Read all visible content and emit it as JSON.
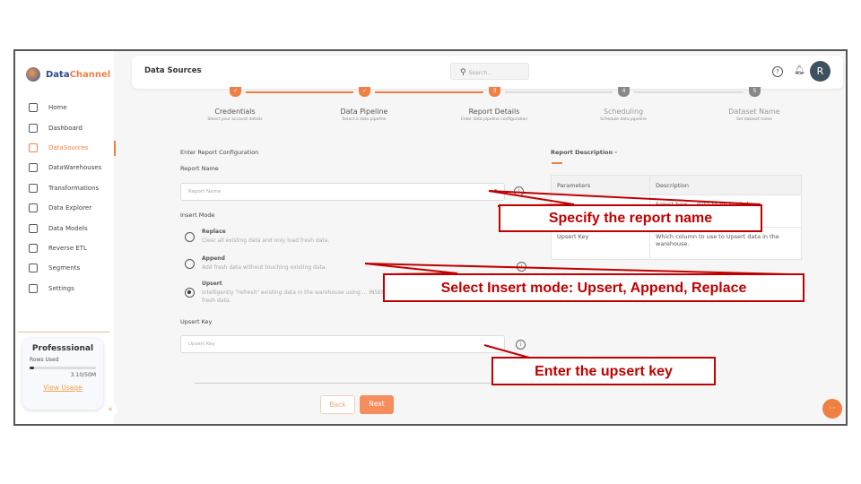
{
  "brand": {
    "name_part1": "Data",
    "name_part2": "Channel"
  },
  "sidebar": {
    "items": [
      {
        "label": "Home",
        "icon": "home-icon"
      },
      {
        "label": "Dashboard",
        "icon": "dashboard-icon"
      },
      {
        "label": "DataSources",
        "icon": "datasources-icon",
        "active": true
      },
      {
        "label": "DataWarehouses",
        "icon": "layers-icon"
      },
      {
        "label": "Transformations",
        "icon": "transform-icon"
      },
      {
        "label": "Data Explorer",
        "icon": "explorer-icon"
      },
      {
        "label": "Data Models",
        "icon": "models-icon"
      },
      {
        "label": "Reverse ETL",
        "icon": "reverse-etl-icon"
      },
      {
        "label": "Segments",
        "icon": "segments-icon"
      },
      {
        "label": "Settings",
        "icon": "gear-icon"
      }
    ],
    "plan": {
      "title": "Professsional",
      "rows_label": "Rows Used",
      "usage_fraction": 0.062,
      "usage_text": "3.10/50M",
      "link": "View Usage"
    },
    "collapse": "«"
  },
  "header": {
    "title": "Data Sources",
    "search_placeholder": "Search...",
    "avatar": "R"
  },
  "steps": [
    {
      "num": "✓",
      "title": "Credentials",
      "sub": "Select your account details",
      "state": "done"
    },
    {
      "num": "✓",
      "title": "Data Pipeline",
      "sub": "Select a data pipeline",
      "state": "done"
    },
    {
      "num": "3",
      "title": "Report Details",
      "sub": "Enter data pipeline configuration",
      "state": "current"
    },
    {
      "num": "4",
      "title": "Scheduling",
      "sub": "Schedule data pipeline",
      "state": "todo"
    },
    {
      "num": "5",
      "title": "Dataset Name",
      "sub": "Set dataset name",
      "state": "todo"
    }
  ],
  "form": {
    "section": "Enter Report Configuration",
    "report_name_label": "Report Name",
    "report_name_placeholder": "Report Name",
    "insert_mode_label": "Insert Mode",
    "modes": [
      {
        "title": "Replace",
        "desc": "Clear all existing data and only load fresh data.",
        "selected": false
      },
      {
        "title": "Append",
        "desc": "Add fresh data without touching existing data.",
        "selected": false
      },
      {
        "title": "Upsert",
        "desc": "Intelligently \"refresh\" existing data in the warehouse using ... INSERT fresh data.",
        "selected": true
      }
    ],
    "upsert_key_label": "Upsert Key",
    "upsert_key_placeholder": "Upsert Key",
    "back": "Back",
    "next": "Next"
  },
  "description": {
    "title": "Report Description -",
    "headers": [
      "Parameters",
      "Description"
    ],
    "rows": [
      [
        "",
        "Select how ... data to be loaded"
      ],
      [
        "Upsert Key",
        "Which column to use to Upsert data in the warehouse."
      ]
    ]
  },
  "annotations": [
    "Specify the report name",
    "Select Insert mode: Upsert, Append, Replace",
    "Enter the upsert key"
  ],
  "colors": {
    "accent": "#f07f44",
    "annotation": "#c00000"
  }
}
